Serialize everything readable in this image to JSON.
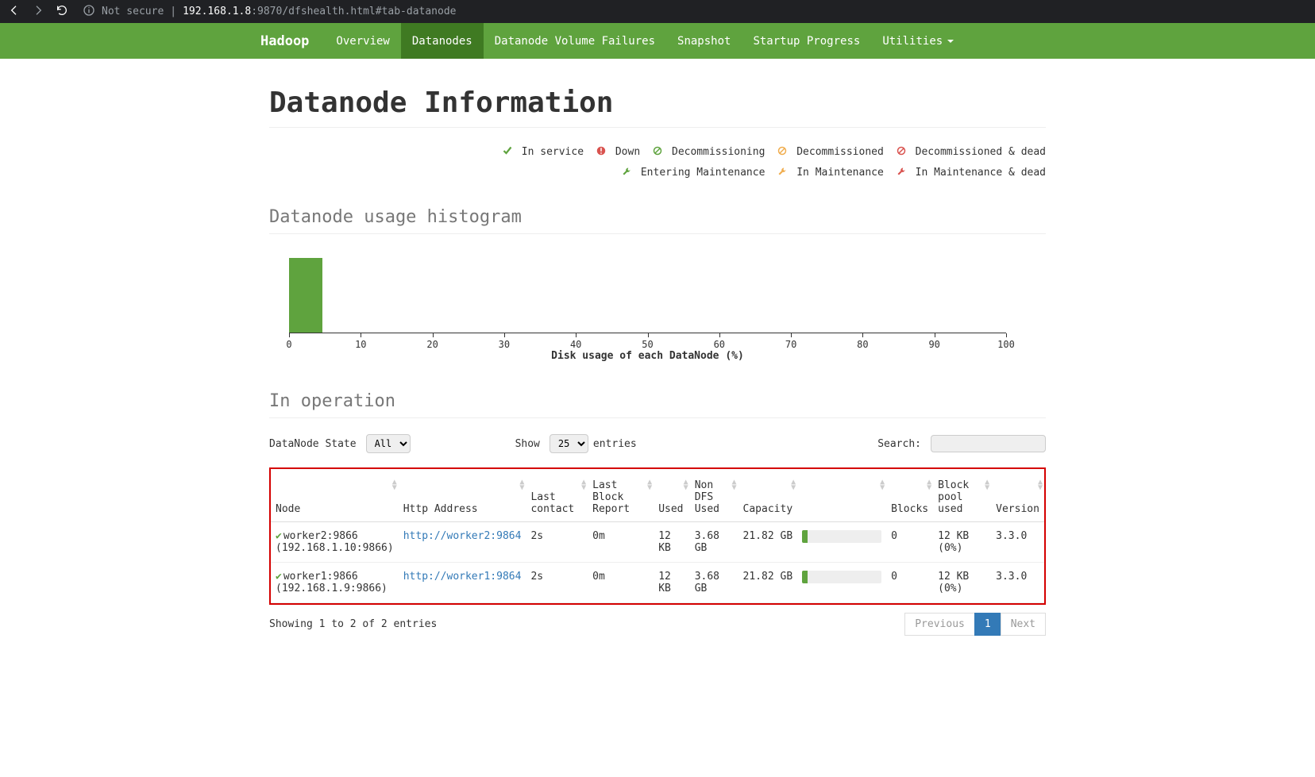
{
  "browser": {
    "not_secure_label": "Not secure",
    "url_host": "192.168.1.8",
    "url_rest": ":9870/dfshealth.html#tab-datanode"
  },
  "nav": {
    "brand": "Hadoop",
    "items": [
      "Overview",
      "Datanodes",
      "Datanode Volume Failures",
      "Snapshot",
      "Startup Progress",
      "Utilities"
    ],
    "active_index": 1
  },
  "page": {
    "title": "Datanode Information"
  },
  "legend": {
    "row1": [
      {
        "key": "in_service",
        "label": "In service",
        "color": "#5fa33e",
        "shape": "check"
      },
      {
        "key": "down",
        "label": "Down",
        "color": "#d9534f",
        "shape": "exclaim"
      },
      {
        "key": "decommissioning",
        "label": "Decommissioning",
        "color": "#5fa33e",
        "shape": "slash"
      },
      {
        "key": "decommissioned",
        "label": "Decommissioned",
        "color": "#f0ad4e",
        "shape": "slash"
      },
      {
        "key": "decommissioned_dead",
        "label": "Decommissioned & dead",
        "color": "#d9534f",
        "shape": "slash"
      }
    ],
    "row2": [
      {
        "key": "entering_maint",
        "label": "Entering Maintenance",
        "color": "#5fa33e",
        "shape": "wrench"
      },
      {
        "key": "in_maint",
        "label": "In Maintenance",
        "color": "#f0ad4e",
        "shape": "wrench"
      },
      {
        "key": "in_maint_dead",
        "label": "In Maintenance & dead",
        "color": "#d9534f",
        "shape": "wrench"
      }
    ]
  },
  "histogram": {
    "title": "Datanode usage histogram",
    "x_title": "Disk usage of each DataNode (%)"
  },
  "chart_data": {
    "type": "bar",
    "title": "Datanode usage histogram",
    "xlabel": "Disk usage of each DataNode (%)",
    "ylabel": "",
    "x_ticks": [
      0,
      10,
      20,
      30,
      40,
      50,
      60,
      70,
      80,
      90,
      100
    ],
    "xlim": [
      0,
      100
    ],
    "categories": [
      "0-10",
      "10-20",
      "20-30",
      "30-40",
      "40-50",
      "50-60",
      "60-70",
      "70-80",
      "80-90",
      "90-100"
    ],
    "values": [
      2,
      0,
      0,
      0,
      0,
      0,
      0,
      0,
      0,
      0
    ]
  },
  "in_operation": {
    "title": "In operation",
    "state_label": "DataNode State",
    "state_value": "All",
    "show_label": "Show",
    "show_value": "25",
    "entries_label": "entries",
    "search_label": "Search:",
    "columns": [
      "Node",
      "Http Address",
      "Last contact",
      "Last Block Report",
      "Used",
      "Non DFS Used",
      "Capacity",
      "",
      "Blocks",
      "Block pool used",
      "Version"
    ],
    "rows": [
      {
        "node_name": "worker2:9866",
        "node_addr": "(192.168.1.10:9866)",
        "http": "http://worker2:9864",
        "last_contact": "2s",
        "last_block": "0m",
        "used": "12 KB",
        "non_dfs": "3.68 GB",
        "capacity": "21.82 GB",
        "cap_pct": 7,
        "blocks": "0",
        "pool_used": "12 KB (0%)",
        "version": "3.3.0"
      },
      {
        "node_name": "worker1:9866",
        "node_addr": "(192.168.1.9:9866)",
        "http": "http://worker1:9864",
        "last_contact": "2s",
        "last_block": "0m",
        "used": "12 KB",
        "non_dfs": "3.68 GB",
        "capacity": "21.82 GB",
        "cap_pct": 7,
        "blocks": "0",
        "pool_used": "12 KB (0%)",
        "version": "3.3.0"
      }
    ],
    "info_text": "Showing 1 to 2 of 2 entries",
    "pagination": {
      "prev": "Previous",
      "page": "1",
      "next": "Next"
    }
  }
}
